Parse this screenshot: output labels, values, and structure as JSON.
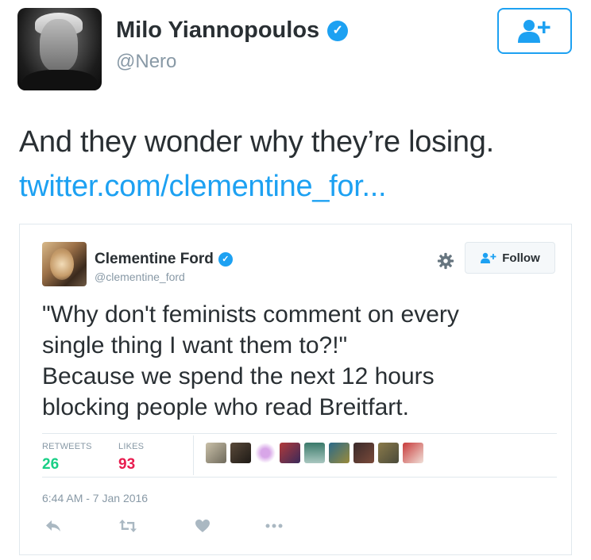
{
  "outer_tweet": {
    "author_name": "Milo Yiannopoulos",
    "author_handle": "@Nero",
    "text": "And they wonder why they’re losing.",
    "link": "twitter.com/clementine_for..."
  },
  "embedded_tweet": {
    "author_name": "Clementine Ford",
    "author_handle": "@clementine_ford",
    "follow_label": "Follow",
    "text_lines": [
      "\"Why don't feminists comment on every",
      "single thing I want them to?!\"",
      "Because we spend the next 12 hours",
      "blocking people who read Breitfart."
    ],
    "stats": {
      "retweets_label": "RETWEETS",
      "retweets_value": "26",
      "likes_label": "LIKES",
      "likes_value": "93"
    },
    "timestamp": "6:44 AM - 7 Jan 2016"
  },
  "icons": {
    "verified": "verified-badge-icon",
    "follow_outer": "add-user-icon",
    "gear": "gear-icon",
    "reply": "reply-icon",
    "retweet": "retweet-icon",
    "like": "heart-icon",
    "more": "more-dots-icon"
  },
  "colors": {
    "twitter_blue": "#1da1f2",
    "text": "#292f33",
    "muted": "#8899a6",
    "stat_green": "#19cf86",
    "border": "#e1e8ed"
  }
}
